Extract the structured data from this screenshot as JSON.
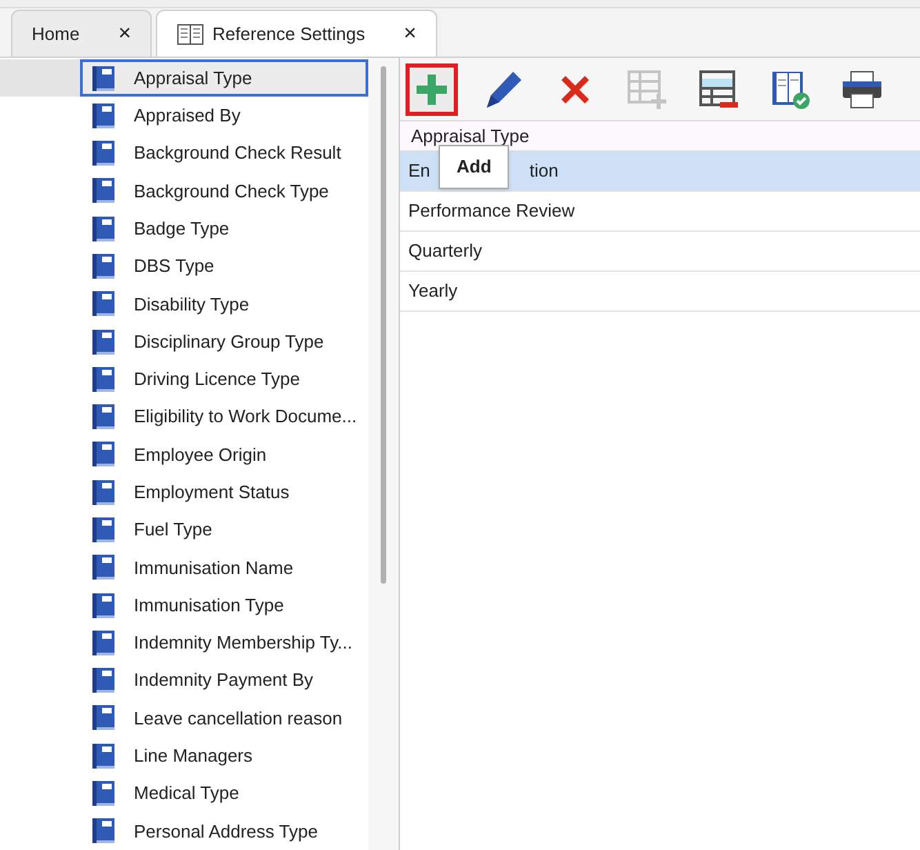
{
  "tabs": [
    {
      "label": "Home",
      "selected": false,
      "kind": "plain",
      "close": "×"
    },
    {
      "label": "Reference Settings",
      "selected": true,
      "kind": "book",
      "close": "×"
    }
  ],
  "sidebar": {
    "items": [
      {
        "label": "Appraisal Type",
        "selected": true
      },
      {
        "label": "Appraised By",
        "selected": false
      },
      {
        "label": "Background Check Result",
        "selected": false
      },
      {
        "label": "Background Check Type",
        "selected": false
      },
      {
        "label": "Badge Type",
        "selected": false
      },
      {
        "label": "DBS Type",
        "selected": false
      },
      {
        "label": "Disability Type",
        "selected": false
      },
      {
        "label": "Disciplinary Group Type",
        "selected": false
      },
      {
        "label": "Driving Licence Type",
        "selected": false
      },
      {
        "label": "Eligibility to Work Docume...",
        "selected": false
      },
      {
        "label": "Employee Origin",
        "selected": false
      },
      {
        "label": "Employment Status",
        "selected": false
      },
      {
        "label": "Fuel Type",
        "selected": false
      },
      {
        "label": "Immunisation Name",
        "selected": false
      },
      {
        "label": "Immunisation Type",
        "selected": false
      },
      {
        "label": "Indemnity Membership Ty...",
        "selected": false
      },
      {
        "label": "Indemnity Payment By",
        "selected": false
      },
      {
        "label": "Leave cancellation reason",
        "selected": false
      },
      {
        "label": "Line Managers",
        "selected": false
      },
      {
        "label": "Medical Type",
        "selected": false
      },
      {
        "label": "Personal Address Type",
        "selected": false
      }
    ]
  },
  "toolbar": {
    "buttons": [
      {
        "kind": "add",
        "highlighted": true,
        "disabled": false
      },
      {
        "kind": "edit",
        "highlighted": false,
        "disabled": false
      },
      {
        "kind": "delete",
        "highlighted": false,
        "disabled": false
      },
      {
        "kind": "add-row",
        "highlighted": false,
        "disabled": true
      },
      {
        "kind": "remove-row",
        "highlighted": false,
        "disabled": false
      },
      {
        "kind": "book-check",
        "highlighted": false,
        "disabled": false
      },
      {
        "kind": "print",
        "highlighted": false,
        "disabled": false
      }
    ],
    "tooltip": "Add"
  },
  "table": {
    "columns": [
      "Appraisal Type"
    ],
    "rows": [
      {
        "parts": [
          "En",
          "tion"
        ],
        "selected": true
      },
      {
        "parts": [
          "Performance Review"
        ],
        "selected": false
      },
      {
        "parts": [
          "Quarterly"
        ],
        "selected": false
      },
      {
        "parts": [
          "Yearly"
        ],
        "selected": false
      }
    ]
  }
}
